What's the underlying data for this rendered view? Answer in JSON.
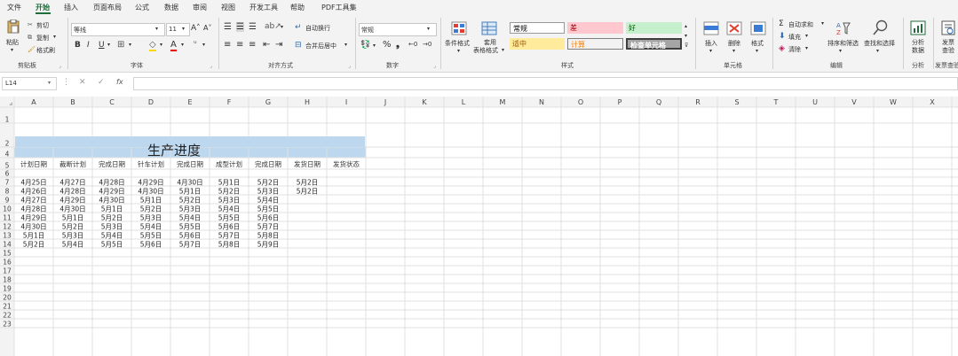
{
  "menu": [
    "文件",
    "开始",
    "插入",
    "页面布局",
    "公式",
    "数据",
    "审阅",
    "视图",
    "开发工具",
    "帮助",
    "PDF工具集"
  ],
  "active_menu": "开始",
  "ribbon": {
    "paste": "粘贴",
    "cut": "剪切",
    "copy": "复制",
    "format_painter": "格式刷",
    "clipboard_group": "剪贴板",
    "font_name": "等线",
    "font_size": "11",
    "font_group": "字体",
    "wrap_text": "自动换行",
    "merge_center": "合并后居中",
    "alignment_group": "对齐方式",
    "number_format": "常规",
    "number_group": "数字",
    "conditional_format": "条件格式",
    "table_format": "套用\n表格格式",
    "styles": [
      {
        "label": "常规",
        "bg": "#ffffff",
        "fg": "#000000"
      },
      {
        "label": "差",
        "bg": "#ffc7ce",
        "fg": "#9c0006"
      },
      {
        "label": "好",
        "bg": "#c6efce",
        "fg": "#006100"
      },
      {
        "label": "适中",
        "bg": "#ffeb9c",
        "fg": "#9c5700"
      },
      {
        "label": "计算",
        "bg": "#f2f2f2",
        "fg": "#fa7d00"
      },
      {
        "label": "检查单元格",
        "bg": "#a5a5a5",
        "fg": "#ffffff"
      }
    ],
    "styles_group": "样式",
    "insert": "插入",
    "delete": "删除",
    "format": "格式",
    "cells_group": "单元格",
    "autosum": "自动求和",
    "fill": "填充",
    "clear": "清除",
    "sort_filter": "排序和筛选",
    "find_select": "查找和选择",
    "editing_group": "编辑",
    "analyze_data": "分析\n数据",
    "analysis_group": "分析",
    "invoice_check": "发票\n查验",
    "invoice_group": "发票查验"
  },
  "formula_bar": {
    "name_box": "L14",
    "formula": ""
  },
  "columns": [
    "A",
    "B",
    "C",
    "D",
    "E",
    "F",
    "G",
    "H",
    "I",
    "J",
    "K",
    "L",
    "M",
    "N",
    "O",
    "P",
    "Q",
    "R",
    "S",
    "T",
    "U",
    "V",
    "W",
    "X"
  ],
  "rows": [
    "1",
    "2",
    "4",
    "5",
    "6",
    "7",
    "8",
    "9",
    "10",
    "11",
    "12",
    "13",
    "14",
    "15",
    "16",
    "17",
    "18",
    "19",
    "20",
    "21",
    "22",
    "23"
  ],
  "sheet_title": "生产进度",
  "headers": [
    "计划日期",
    "裁断计划",
    "完成日期",
    "针车计划",
    "完成日期",
    "成型计划",
    "完成日期",
    "发货日期",
    "发货状态"
  ],
  "table": [
    [
      "4月25日",
      "4月27日",
      "4月28日",
      "4月29日",
      "4月30日",
      "5月1日",
      "5月2日",
      "5月2日",
      ""
    ],
    [
      "4月26日",
      "4月28日",
      "4月29日",
      "4月30日",
      "5月1日",
      "5月2日",
      "5月3日",
      "5月2日",
      ""
    ],
    [
      "4月27日",
      "4月29日",
      "4月30日",
      "5月1日",
      "5月2日",
      "5月3日",
      "5月4日",
      "",
      ""
    ],
    [
      "4月28日",
      "4月30日",
      "5月1日",
      "5月2日",
      "5月3日",
      "5月4日",
      "5月5日",
      "",
      ""
    ],
    [
      "4月29日",
      "5月1日",
      "5月2日",
      "5月3日",
      "5月4日",
      "5月5日",
      "5月6日",
      "",
      ""
    ],
    [
      "4月30日",
      "5月2日",
      "5月3日",
      "5月4日",
      "5月5日",
      "5月6日",
      "5月7日",
      "",
      ""
    ],
    [
      "5月1日",
      "5月3日",
      "5月4日",
      "5月5日",
      "5月6日",
      "5月7日",
      "5月8日",
      "",
      ""
    ],
    [
      "5月2日",
      "5月4日",
      "5月5日",
      "5月6日",
      "5月7日",
      "5月8日",
      "5月9日",
      "",
      ""
    ]
  ],
  "colors": {
    "title_fill": "#bdd7ee",
    "accent": "#1f6d3a",
    "grid_line": "#e0e0e0"
  }
}
